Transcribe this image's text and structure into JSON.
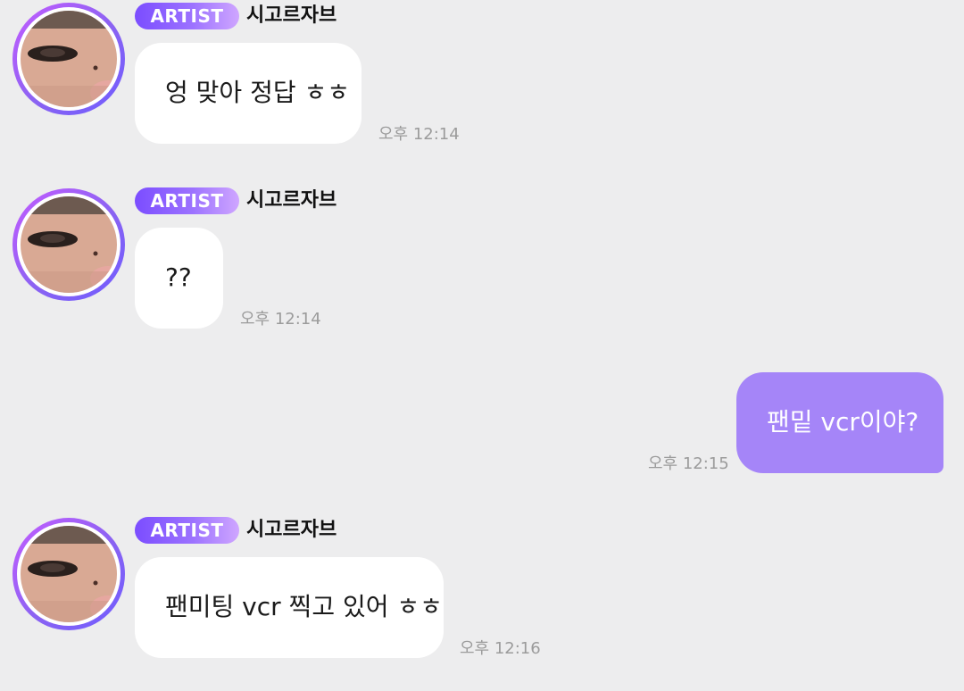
{
  "artist_badge_label": "ARTIST",
  "messages": [
    {
      "sender": "artist",
      "name": "시고르자브",
      "text": "엉 맞아 정답 ㅎㅎ",
      "time": "오후 12:14"
    },
    {
      "sender": "artist",
      "name": "시고르자브",
      "text": "??",
      "time": "오후 12:14"
    },
    {
      "sender": "me",
      "text": "팬밑 vcr이야?",
      "time": "오후 12:15"
    },
    {
      "sender": "artist",
      "name": "시고르자브",
      "text": "팬미팅 vcr 찍고 있어 ㅎㅎ",
      "time": "오후 12:16"
    }
  ],
  "colors": {
    "background": "#ededee",
    "incoming_bubble": "#ffffff",
    "outgoing_bubble": "#a585f8",
    "badge_start": "#7b4dff",
    "badge_end": "#cfa6ff",
    "timestamp": "#9b9b9b"
  }
}
